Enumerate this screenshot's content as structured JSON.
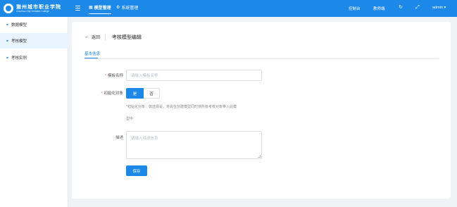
{
  "header": {
    "logo": {
      "name_cn": "滁州城市职业学院",
      "name_en": "Chuzhou City Vocation College"
    },
    "nav": [
      {
        "label": "模型管理",
        "icon": "dashboard-icon"
      },
      {
        "label": "系统管理",
        "icon": "settings-cog-icon"
      }
    ],
    "right": {
      "control_center": "控制台",
      "workbench": "教师端",
      "user": "admin"
    },
    "colors": {
      "primary": "#1c88e8"
    }
  },
  "sidebar": {
    "items": [
      {
        "label": "数据模型",
        "icon": "link-icon"
      },
      {
        "label": "考核模型",
        "icon": "link-icon"
      },
      {
        "label": "考核实例",
        "icon": "link-icon"
      }
    ]
  },
  "page": {
    "back_label": "返回",
    "title": "考核模型编辑",
    "tab": "基本信息"
  },
  "form": {
    "name_label": "模板名称",
    "name_placeholder": "请输入模板名称",
    "init_label": "初始化对象",
    "yes": "是",
    "no": "否",
    "hint_line1": "*初始化对象：如选择是，将会在创建模型同时将所有考核对象带入此模",
    "hint_line2": "型中",
    "desc_label": "描述",
    "desc_placeholder": "请输入描述信息",
    "save": "保存"
  }
}
